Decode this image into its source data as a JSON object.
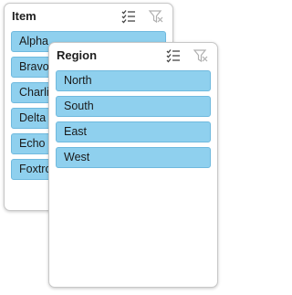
{
  "item_slicer": {
    "title": "Item",
    "items": [
      "Alpha",
      "Bravo",
      "Charlie",
      "Delta",
      "Echo",
      "Foxtrot"
    ],
    "multi_select_icon": "multi-select-icon",
    "clear_filter_icon": "clear-filter-icon"
  },
  "region_slicer": {
    "title": "Region",
    "items": [
      "North",
      "South",
      "East",
      "West"
    ],
    "multi_select_icon": "multi-select-icon",
    "clear_filter_icon": "clear-filter-icon"
  },
  "colors": {
    "item_fill": "#8fd0ee",
    "item_border": "#6fb9de",
    "panel_border": "#c8c8c8",
    "icon_active": "#444444",
    "icon_disabled": "#b0b0b0"
  }
}
